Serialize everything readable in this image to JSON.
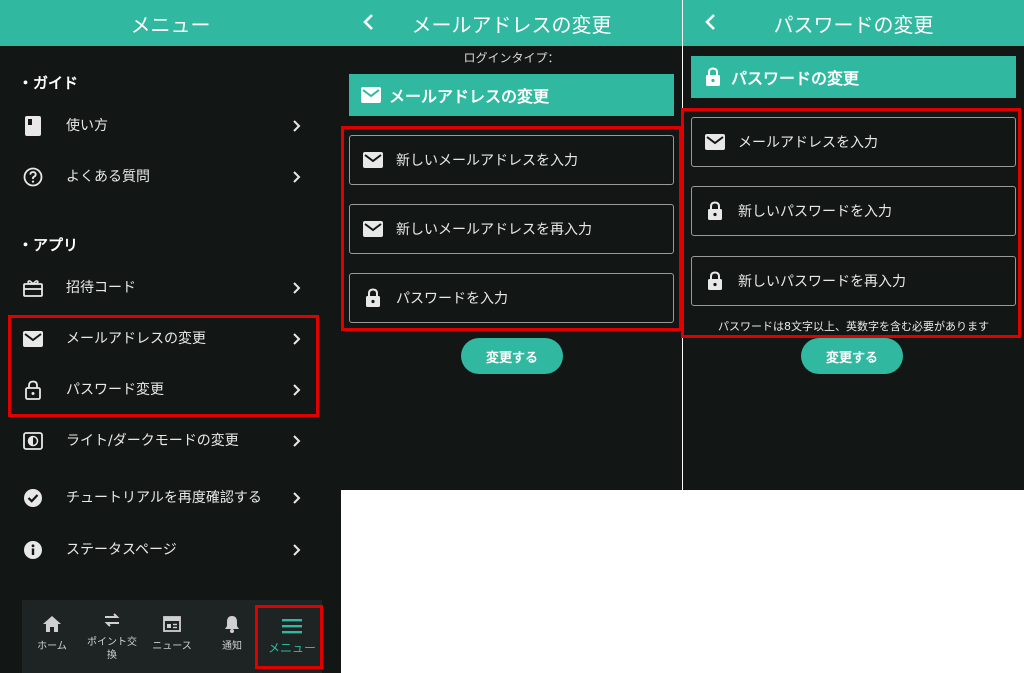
{
  "menu": {
    "header_title": "メニュー",
    "sections": [
      {
        "title": "・ガイド"
      },
      {
        "title": "・アプリ"
      }
    ],
    "items": [
      {
        "label": "使い方",
        "icon": "book-icon"
      },
      {
        "label": "よくある質問",
        "icon": "question-circle-icon"
      },
      {
        "label": "招待コード",
        "icon": "gift-icon"
      },
      {
        "label": "メールアドレスの変更",
        "icon": "mail-icon"
      },
      {
        "label": "パスワード変更",
        "icon": "lock-icon"
      },
      {
        "label": "ライト/ダークモードの変更",
        "icon": "contrast-icon"
      },
      {
        "label": "チュートリアルを再度確認する",
        "icon": "check-circle-icon"
      },
      {
        "label": "ステータスページ",
        "icon": "info-circle-icon"
      }
    ],
    "bottom_nav": [
      {
        "label": "ホーム",
        "icon": "home-icon"
      },
      {
        "label": "ポイント交換",
        "icon": "exchange-icon"
      },
      {
        "label": "ニュース",
        "icon": "news-icon"
      },
      {
        "label": "通知",
        "icon": "bell-icon"
      },
      {
        "label": "メニュー",
        "icon": "hamburger-icon",
        "active": true
      }
    ]
  },
  "email_change": {
    "header_title": "メールアドレスの変更",
    "login_type_label": "ログインタイプ：",
    "section_title": "メールアドレスの変更",
    "fields": [
      {
        "placeholder": "新しいメールアドレスを入力",
        "icon": "mail-icon"
      },
      {
        "placeholder": "新しいメールアドレスを再入力",
        "icon": "mail-icon"
      },
      {
        "placeholder": "パスワードを入力",
        "icon": "lock-icon"
      }
    ],
    "submit_label": "変更する"
  },
  "password_change": {
    "header_title": "パスワードの変更",
    "section_title": "パスワードの変更",
    "fields": [
      {
        "placeholder": "メールアドレスを入力",
        "icon": "mail-icon"
      },
      {
        "placeholder": "新しいパスワードを入力",
        "icon": "lock-icon"
      },
      {
        "placeholder": "新しいパスワードを再入力",
        "icon": "lock-icon"
      }
    ],
    "hint": "パスワードは8文字以上、英数字を含む必要があります",
    "submit_label": "変更する"
  },
  "colors": {
    "accent": "#30b8a0",
    "background": "#121716",
    "highlight": "#e00000"
  }
}
